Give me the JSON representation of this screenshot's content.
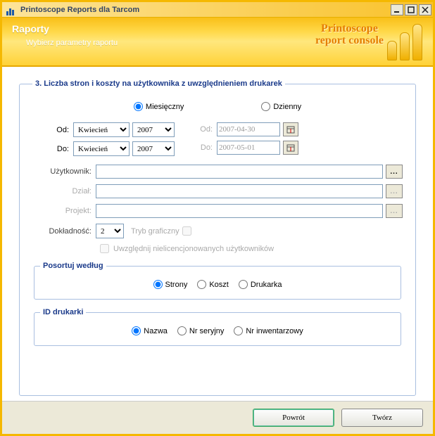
{
  "window": {
    "title": "Printoscope Reports dla Tarcom"
  },
  "header": {
    "title": "Raporty",
    "subtitle": "Wybierz parametry raportu",
    "brand_line1": "Printoscope",
    "brand_line2": "report console"
  },
  "section": {
    "legend": "3. Liczba stron i koszty na użytkownika z uwzględnieniem drukarek"
  },
  "period": {
    "monthly_label": "Miesięczny",
    "daily_label": "Dzienny",
    "selected": "monthly",
    "from_label": "Od:",
    "to_label": "Do:",
    "from_month": "Kwiecień",
    "from_year": "2007",
    "to_month": "Kwiecień",
    "to_year": "2007",
    "daily_from_label": "Od:",
    "daily_to_label": "Do:",
    "daily_from": "2007-04-30",
    "daily_to": "2007-05-01"
  },
  "filters": {
    "user_label": "Użytkownik:",
    "user_value": "",
    "dept_label": "Dział:",
    "dept_value": "",
    "project_label": "Projekt:",
    "project_value": "",
    "precision_label": "Dokładność:",
    "precision_value": "2",
    "graphic_mode_label": "Tryb graficzny",
    "include_unlicensed_label": "Uwzględnij nielicencjonowanych użytkowników"
  },
  "sort": {
    "legend": "Posortuj według",
    "options": [
      "Strony",
      "Koszt",
      "Drukarka"
    ],
    "selected": "Strony"
  },
  "printer_id": {
    "legend": "ID drukarki",
    "options": [
      "Nazwa",
      "Nr seryjny",
      "Nr inwentarzowy"
    ],
    "selected": "Nazwa"
  },
  "buttons": {
    "back": "Powrót",
    "create": "Twórz"
  }
}
